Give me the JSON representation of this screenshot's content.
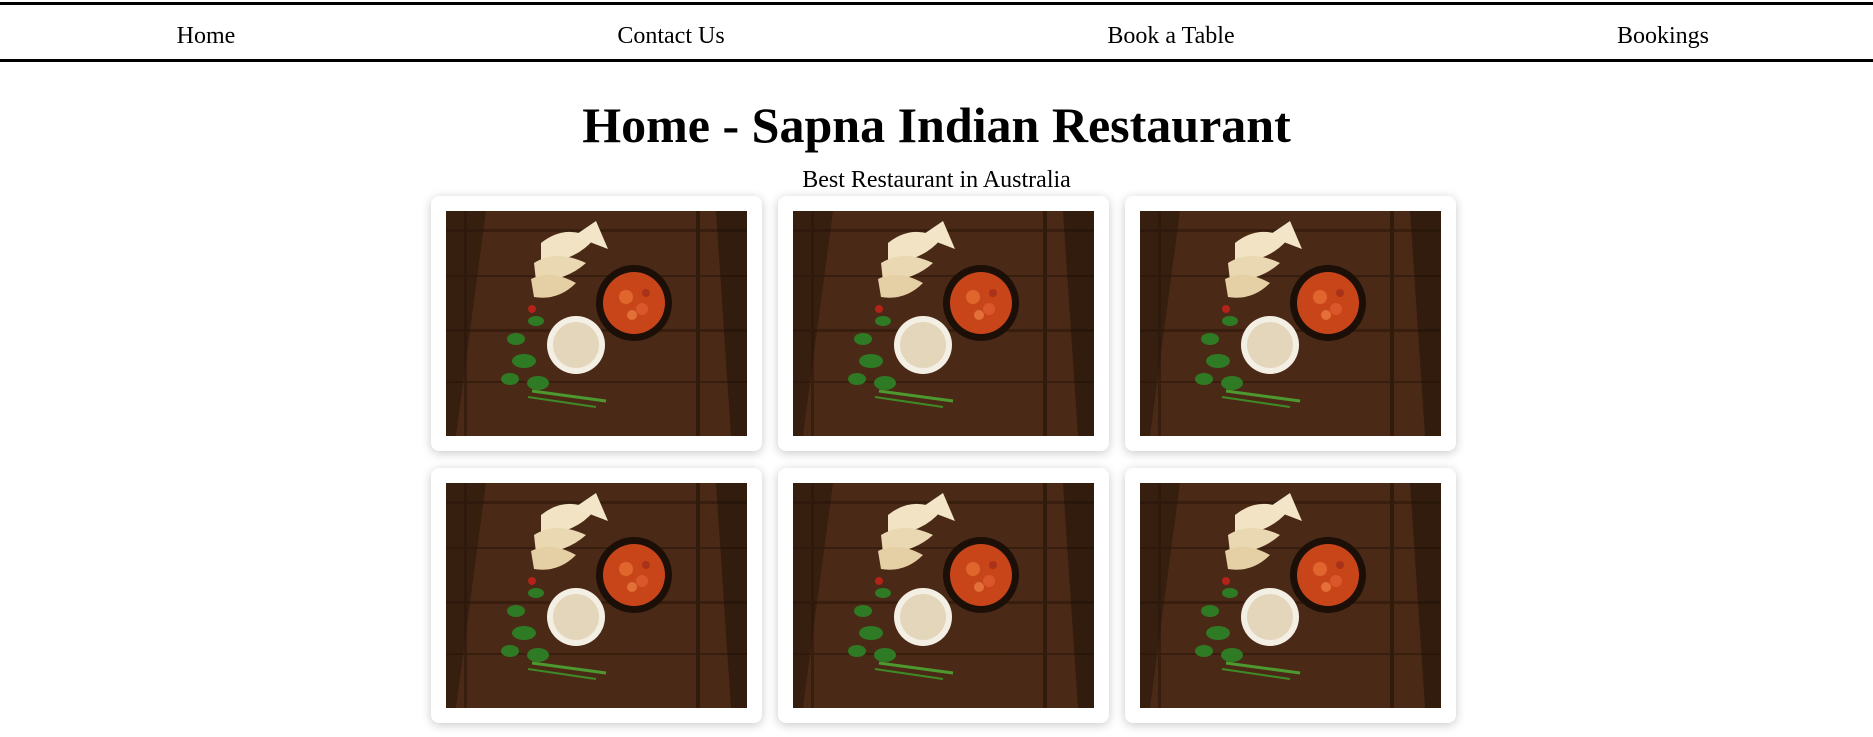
{
  "nav": {
    "items": [
      {
        "label": "Home"
      },
      {
        "label": "Contact Us"
      },
      {
        "label": "Book a Table"
      },
      {
        "label": "Bookings"
      }
    ]
  },
  "page": {
    "title": "Home - Sapna Indian Restaurant",
    "subtitle": "Best Restaurant in Australia"
  },
  "gallery": {
    "image_subject": "indian-curry-dish-photo",
    "count": 6
  }
}
